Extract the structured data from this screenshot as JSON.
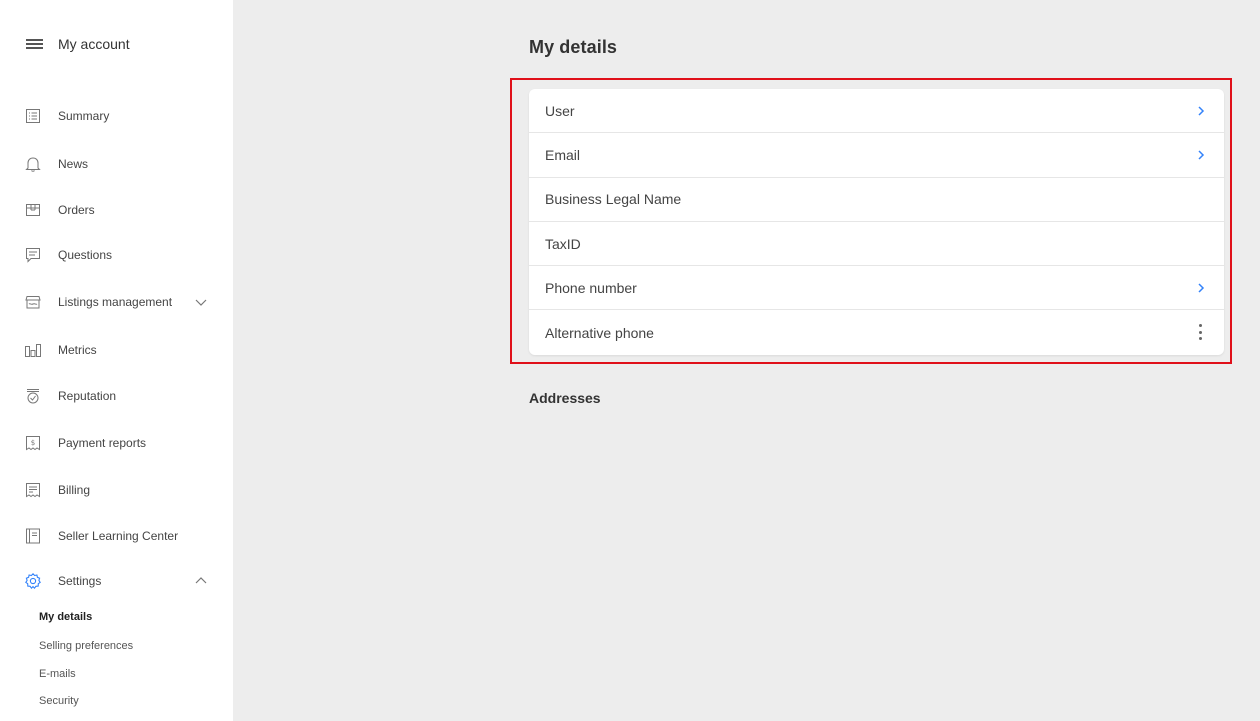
{
  "sidebar": {
    "title": "My account",
    "items": [
      {
        "label": "Summary",
        "icon": "list-icon"
      },
      {
        "label": "News",
        "icon": "bell-icon"
      },
      {
        "label": "Orders",
        "icon": "box-icon"
      },
      {
        "label": "Questions",
        "icon": "chat-icon"
      },
      {
        "label": "Listings management",
        "icon": "store-icon",
        "expanded": false
      },
      {
        "label": "Metrics",
        "icon": "bar-chart-icon"
      },
      {
        "label": "Reputation",
        "icon": "badge-icon"
      },
      {
        "label": "Payment reports",
        "icon": "dollar-receipt-icon"
      },
      {
        "label": "Billing",
        "icon": "receipt-icon"
      },
      {
        "label": "Seller Learning Center",
        "icon": "book-icon"
      },
      {
        "label": "Settings",
        "icon": "gear-icon",
        "expanded": true
      }
    ],
    "settings_sub": [
      {
        "label": "My details",
        "active": true
      },
      {
        "label": "Selling preferences",
        "active": false
      },
      {
        "label": "E-mails",
        "active": false
      },
      {
        "label": "Security",
        "active": false
      }
    ]
  },
  "main": {
    "title": "My details",
    "details": [
      {
        "label": "User",
        "action": "chevron"
      },
      {
        "label": "Email",
        "action": "chevron"
      },
      {
        "label": "Business Legal Name",
        "action": "none"
      },
      {
        "label": "TaxID",
        "action": "none"
      },
      {
        "label": "Phone number",
        "action": "chevron"
      },
      {
        "label": "Alternative phone",
        "action": "kebab"
      }
    ],
    "addresses_title": "Addresses"
  },
  "colors": {
    "accent": "#3483fa",
    "highlight": "#e0101a",
    "background": "#ededed"
  }
}
